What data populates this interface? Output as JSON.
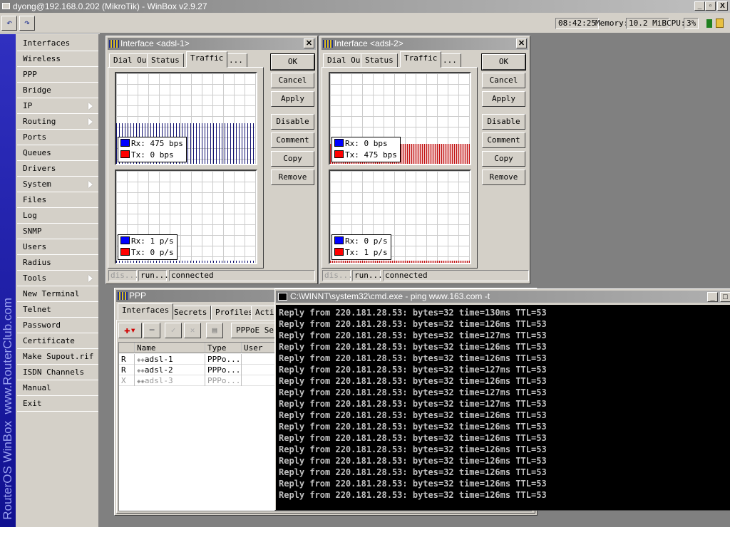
{
  "app": {
    "title": "dyong@192.168.0.202 (MikroTik) - WinBox v2.9.27"
  },
  "toolbar": {
    "undo": "undo-icon",
    "redo": "redo-icon",
    "time": "08:42:25",
    "memory_label": "Memory:",
    "memory": "10.2 MiB",
    "cpu_label": "CPU:",
    "cpu": "3%"
  },
  "sidebar": {
    "brand": "RouterOS WinBox  www.RouterClub.com",
    "items": [
      {
        "label": "Interfaces"
      },
      {
        "label": "Wireless"
      },
      {
        "label": "PPP"
      },
      {
        "label": "Bridge"
      },
      {
        "label": "IP",
        "sub": true
      },
      {
        "label": "Routing",
        "sub": true
      },
      {
        "label": "Ports"
      },
      {
        "label": "Queues"
      },
      {
        "label": "Drivers"
      },
      {
        "label": "System",
        "sub": true
      },
      {
        "label": "Files"
      },
      {
        "label": "Log"
      },
      {
        "label": "SNMP"
      },
      {
        "label": "Users"
      },
      {
        "label": "Radius"
      },
      {
        "label": "Tools",
        "sub": true
      },
      {
        "label": "New Terminal"
      },
      {
        "label": "Telnet"
      },
      {
        "label": "Password"
      },
      {
        "label": "Certificate"
      },
      {
        "label": "Make Supout.rif"
      },
      {
        "label": "ISDN Channels"
      },
      {
        "label": "Manual"
      },
      {
        "label": "Exit"
      }
    ]
  },
  "iface_windows": [
    {
      "title": "Interface <adsl-1>",
      "tabs": [
        "Dial Out",
        "Status",
        "Traffic",
        "..."
      ],
      "active_tab": 2,
      "bps": {
        "rx": "Rx: 475 bps",
        "tx": "Tx: 0 bps"
      },
      "pps": {
        "rx": "Rx: 1 p/s",
        "tx": "Tx: 0 p/s"
      },
      "buttons": [
        "OK",
        "Cancel",
        "Apply",
        "Disable",
        "Comment",
        "Copy",
        "Remove"
      ],
      "status": [
        "dis...",
        "run...",
        "connected"
      ]
    },
    {
      "title": "Interface <adsl-2>",
      "tabs": [
        "Dial Out",
        "Status",
        "Traffic",
        "..."
      ],
      "active_tab": 2,
      "bps": {
        "rx": "Rx: 0 bps",
        "tx": "Tx: 475 bps"
      },
      "pps": {
        "rx": "Rx: 0 p/s",
        "tx": "Tx: 1 p/s"
      },
      "buttons": [
        "OK",
        "Cancel",
        "Apply",
        "Disable",
        "Comment",
        "Copy",
        "Remove"
      ],
      "status": [
        "dis...",
        "run...",
        "connected"
      ]
    }
  ],
  "colors": {
    "rx": "#0000ff",
    "tx": "#ff0000"
  },
  "ppp": {
    "title": "PPP",
    "tabs": [
      "Interfaces",
      "Secrets",
      "Profiles",
      "Acti"
    ],
    "pppoe_button": "PPPoE Ser",
    "columns": [
      "",
      "Name",
      "Type",
      "User"
    ],
    "rows": [
      {
        "flag": "R",
        "name": "adsl-1",
        "type": "PPPo...",
        "user": ""
      },
      {
        "flag": "R",
        "name": "adsl-2",
        "type": "PPPo...",
        "user": ""
      },
      {
        "flag": "X",
        "name": "adsl-3",
        "type": "PPPo...",
        "user": "",
        "disabled": true
      }
    ]
  },
  "cmd": {
    "title": "C:\\WINNT\\system32\\cmd.exe - ping www.163.com -t",
    "lines": [
      "Reply from 220.181.28.53: bytes=32 time=130ms TTL=53",
      "Reply from 220.181.28.53: bytes=32 time=126ms TTL=53",
      "Reply from 220.181.28.53: bytes=32 time=127ms TTL=53",
      "Reply from 220.181.28.53: bytes=32 time=126ms TTL=53",
      "Reply from 220.181.28.53: bytes=32 time=126ms TTL=53",
      "Reply from 220.181.28.53: bytes=32 time=127ms TTL=53",
      "Reply from 220.181.28.53: bytes=32 time=126ms TTL=53",
      "Reply from 220.181.28.53: bytes=32 time=127ms TTL=53",
      "Reply from 220.181.28.53: bytes=32 time=127ms TTL=53",
      "Reply from 220.181.28.53: bytes=32 time=126ms TTL=53",
      "Reply from 220.181.28.53: bytes=32 time=126ms TTL=53",
      "Reply from 220.181.28.53: bytes=32 time=126ms TTL=53",
      "Reply from 220.181.28.53: bytes=32 time=126ms TTL=53",
      "Reply from 220.181.28.53: bytes=32 time=126ms TTL=53",
      "Reply from 220.181.28.53: bytes=32 time=126ms TTL=53",
      "Reply from 220.181.28.53: bytes=32 time=126ms TTL=53",
      "Reply from 220.181.28.53: bytes=32 time=126ms TTL=53"
    ]
  }
}
